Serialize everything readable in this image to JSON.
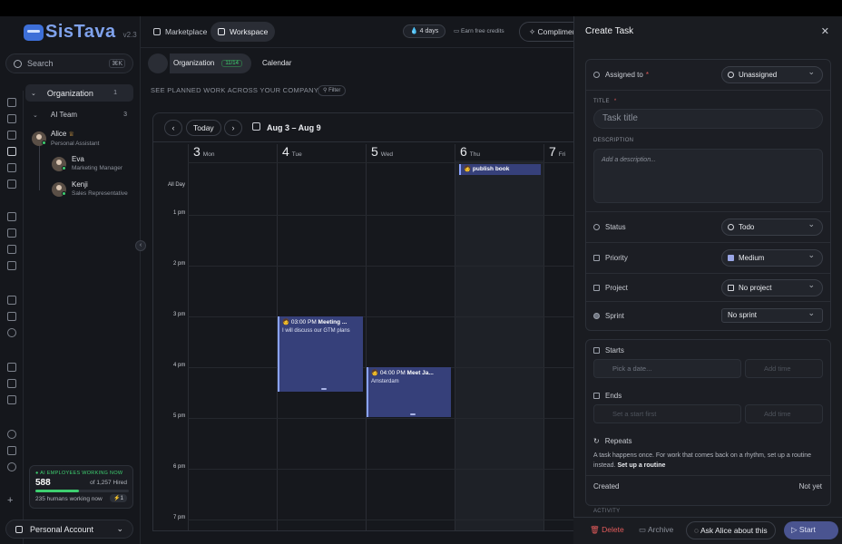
{
  "app": {
    "logo_text": "SisTava",
    "version": "v2.3"
  },
  "search": {
    "label": "Search",
    "shortcut": "⌘K"
  },
  "sidebar": {
    "org_label": "Organization",
    "org_count": "1",
    "team_label": "AI Team",
    "team_count": "3",
    "agents": [
      {
        "name": "Alice",
        "role": "Personal Assistant"
      },
      {
        "name": "Eva",
        "role": "Marketing Manager"
      },
      {
        "name": "Kenji",
        "role": "Sales Representative"
      }
    ],
    "ai_card": {
      "heading": "AI EMPLOYEES WORKING NOW",
      "working": "588",
      "of_hired": "of 1,257 Hired",
      "working_fraction": 0.47,
      "humans": "235 humans working now",
      "bolt": "⚡1"
    },
    "account_label": "Personal Account"
  },
  "topbar": {
    "tab_marketplace": "Marketplace",
    "tab_workspace": "Workspace",
    "days": "💧 4 days",
    "credits": "Earn free credits",
    "compliments": "Complimen"
  },
  "breadcrumb": {
    "org": "Organization",
    "badge": "11/14",
    "page": "Calendar"
  },
  "subheading": "SEE PLANNED WORK ACROSS YOUR COMPANY",
  "filter_label": "Filter",
  "calendar": {
    "today_label": "Today",
    "prev": "‹",
    "next": "›",
    "range": "Aug 3 – Aug 9",
    "days": [
      {
        "num": "3",
        "wd": "Mon"
      },
      {
        "num": "4",
        "wd": "Tue"
      },
      {
        "num": "5",
        "wd": "Wed"
      },
      {
        "num": "6",
        "wd": "Thu"
      },
      {
        "num": "7",
        "wd": "Fri"
      }
    ],
    "allday_label": "All Day",
    "times": [
      "1 pm",
      "2 pm",
      "3 pm",
      "4 pm",
      "5 pm",
      "6 pm",
      "7 pm"
    ],
    "events": {
      "allday_title": "publish book",
      "meeting_time": "03:00 PM",
      "meeting_title": "Meeting ...",
      "meeting_desc": "I will discuss our GTM plans",
      "meet_time": "04:00 PM",
      "meet_title": "Meet Ja...",
      "meet_desc": "Amsterdam"
    }
  },
  "panel": {
    "title": "Create Task",
    "assigned_label": "Assigned to",
    "assigned_value": "Unassigned",
    "title_label": "TITLE",
    "title_placeholder": "Task title",
    "desc_label": "DESCRIPTION",
    "desc_placeholder": "Add a description...",
    "status_label": "Status",
    "status_value": "Todo",
    "priority_label": "Priority",
    "priority_value": "Medium",
    "project_label": "Project",
    "project_value": "No project",
    "sprint_label": "Sprint",
    "sprint_value": "No sprint",
    "starts_label": "Starts",
    "starts_date": "Pick a date...",
    "starts_time": "Add time",
    "ends_label": "Ends",
    "ends_date": "Set a start first",
    "ends_time": "Add time",
    "repeats_label": "Repeats",
    "repeats_text": "A task happens once. For work that comes back on a rhythm, set up a routine instead.",
    "repeats_link": "Set up a routine",
    "created_label": "Created",
    "created_value": "Not yet",
    "activity_label": "ACTIVITY",
    "delete": "Delete",
    "archive": "Archive",
    "ask": "Ask Alice about this",
    "start": "Start now"
  }
}
